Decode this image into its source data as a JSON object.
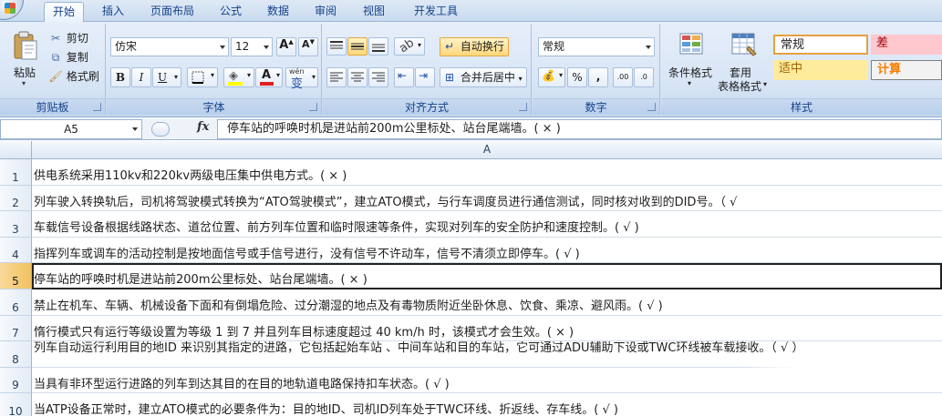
{
  "tabs": [
    {
      "label": "开始",
      "active": true
    },
    {
      "label": "插入"
    },
    {
      "label": "页面布局"
    },
    {
      "label": "公式"
    },
    {
      "label": "数据"
    },
    {
      "label": "审阅"
    },
    {
      "label": "视图"
    },
    {
      "label": "开发工具"
    }
  ],
  "clipboard": {
    "label": "剪贴板",
    "paste": "粘贴",
    "cut": "剪切",
    "copy": "复制",
    "format_painter": "格式刷"
  },
  "font": {
    "label": "字体",
    "name": "仿宋",
    "size": "12",
    "grow": "A",
    "shrink": "A",
    "bold": "B",
    "italic": "I",
    "underline": "U",
    "font_color_letter": "A",
    "phonetic": "wén",
    "phonetic_char": "变",
    "fill_color": "#ffff00",
    "text_color": "#e02020"
  },
  "alignment": {
    "label": "对齐方式",
    "wrap_text": "自动换行",
    "merge_center": "合并后居中"
  },
  "number": {
    "label": "数字",
    "format": "常规",
    "currency": "💰",
    "percent": "%",
    "comma": ",",
    "inc_decimal": ".00",
    "dec_decimal": ".0"
  },
  "styles": {
    "label": "样式",
    "conditional": "条件格式",
    "table_format_1": "套用",
    "table_format_2": "表格格式",
    "normal": "常规",
    "bad": "差",
    "neutral": "中",
    "neutral_prefix": "适",
    "calc": "计算",
    "colors": {
      "normal_border": "#e8a040",
      "bad_bg": "#ffc7ce",
      "bad_text": "#9c0006",
      "neutral_bg": "#ffeb9c",
      "neutral_text": "#9c6500",
      "calc_bg": "#f2f2f2",
      "calc_text": "#fa7d00"
    }
  },
  "formula_bar": {
    "name_box": "A5",
    "fx": "fx",
    "formula": "停车站的呼唤时机是进站前200m公里标处、站台尾端墙。(  ×  )"
  },
  "grid": {
    "column": "A",
    "rows": [
      {
        "num": "1",
        "text": "供电系统采用110kv和220kv两级电压集中供电方式。(  ×  )"
      },
      {
        "num": "2",
        "text": "列车驶入转换轨后，司机将驾驶模式转换为“ATO驾驶模式”，建立ATO模式，与行车调度员进行通信测试，同时核对收到的DID号。（ √"
      },
      {
        "num": "3",
        "text": "车载信号设备根据线路状态、道岔位置、前方列车位置和临时限速等条件，实现对列车的安全防护和速度控制。( √ )"
      },
      {
        "num": "4",
        "text": "指挥列车或调车的活动控制是按地面信号或手信号进行，没有信号不许动车，信号不清须立即停车。( √ )"
      },
      {
        "num": "5",
        "text": "停车站的呼唤时机是进站前200m公里标处、站台尾端墙。(  ×  )"
      },
      {
        "num": "6",
        "text": "禁止在机车、车辆、机械设备下面和有倒塌危险、过分潮湿的地点及有毒物质附近坐卧休息、饮食、乘凉、避风雨。( √ )"
      },
      {
        "num": "7",
        "text": "惰行模式只有运行等级设置为等级 1 到 7 并且列车目标速度超过 40 km/h  时，该模式才会生效。( × )"
      },
      {
        "num": "8",
        "text": "列车自动运行利用目的地ID 来识别其指定的进路，它包括起始车站 、中间车站和目的车站，它可通过ADU辅助下设或TWC环线被车载接收。（ √ ）",
        "wrap": true
      },
      {
        "num": "9",
        "text": "当具有非环型运行进路的列车到达其目的在目的地轨道电路保持扣车状态。( √ )"
      },
      {
        "num": "10",
        "text": "当ATP设备正常时，建立ATO模式的必要条件为：目的地ID、司机ID列车处于TWC环线、折返线、存车线。( √ )"
      }
    ]
  }
}
